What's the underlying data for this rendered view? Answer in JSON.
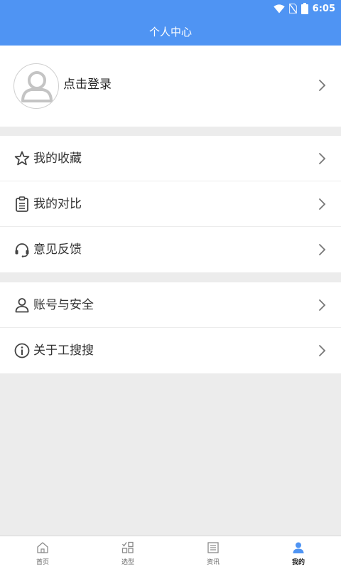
{
  "status_bar": {
    "time": "6:05"
  },
  "header": {
    "title": "个人中心"
  },
  "profile": {
    "login_label": "点击登录"
  },
  "menu_group_1": [
    {
      "label": "我的收藏",
      "icon": "star-icon"
    },
    {
      "label": "我的对比",
      "icon": "clipboard-icon"
    },
    {
      "label": "意见反馈",
      "icon": "headset-icon"
    }
  ],
  "menu_group_2": [
    {
      "label": "账号与安全",
      "icon": "user-icon"
    },
    {
      "label": "关于工搜搜",
      "icon": "info-icon"
    }
  ],
  "tabbar": {
    "active": "我的",
    "active_color": "#4f94f3",
    "items": [
      {
        "label": "首页",
        "icon": "home-icon"
      },
      {
        "label": "选型",
        "icon": "selection-icon"
      },
      {
        "label": "资讯",
        "icon": "news-icon"
      },
      {
        "label": "我的",
        "icon": "person-icon"
      }
    ]
  },
  "colors": {
    "header_bg": "#4f94f3",
    "page_bg": "#ececec"
  }
}
